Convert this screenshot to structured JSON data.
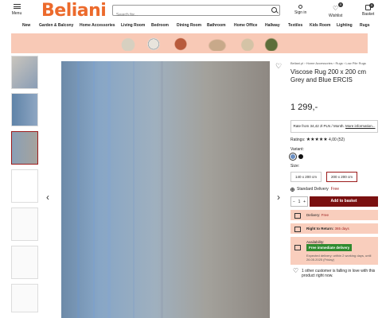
{
  "header": {
    "menu_label": "Menu",
    "logo_text": "Beliani",
    "search_placeholder": "Search for...",
    "signin_label": "Sign in",
    "wishlist_label": "Wishlist",
    "wishlist_count": "0",
    "basket_label": "Basket",
    "basket_count": "0"
  },
  "nav": [
    "New",
    "Garden & Balcony",
    "Home Accessories",
    "Living Room",
    "Bedroom",
    "Dining Room",
    "Bathroom",
    "Home Office",
    "Hallway",
    "Textiles",
    "Kids Room",
    "Lighting",
    "Rugs"
  ],
  "product": {
    "breadcrumb": "Beliani.pl › Home Accessories › Rugs › Low Pile Rugs",
    "title": "Viscose Rug 200 x 200 cm Grey and Blue ERCIS",
    "price": "1 299,-",
    "rate_text": "Rate from 34,42 zł PLN / Month.",
    "rate_link": "More information...",
    "ratings_label": "Ratings:",
    "stars": "★★★★★",
    "rating_score": "4,00 (52)",
    "variant_label": "Variant:",
    "size_label": "Size:",
    "sizes": [
      "140 x 200 cm",
      "200 x 200 cm"
    ],
    "delivery_option": "Standard Delivery",
    "delivery_option_price": "Free",
    "qty": "1",
    "add_label": "Add to basket",
    "delivery_line_label": "Delivery:",
    "delivery_line_value": "Free",
    "return_label": "Right to Return:",
    "return_value": "365 days",
    "availability_label": "Availability:",
    "availability_badge": "Free immediate delivery",
    "expected_text": "Expected delivery: within 2 working days, until 26.05.2025 (Friday)",
    "interest_note": "1 other customer is falling in love with this product right now."
  },
  "colors": {
    "brand": "#ec6a2c",
    "accent_dark_red": "#7a1010",
    "promo_bg": "#f8c9b6",
    "info_box_bg": "#f9cebd",
    "availability_green": "#2f8a2f",
    "swatch_blue": "#6b8fc2",
    "swatch_black": "#111111"
  }
}
